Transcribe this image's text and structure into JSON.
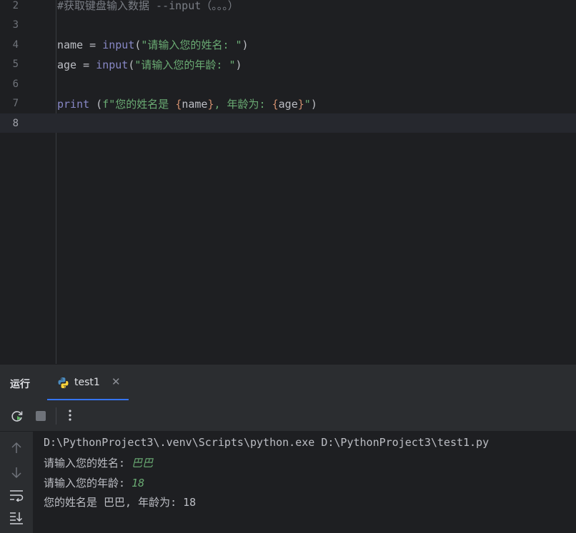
{
  "editor": {
    "lines": [
      {
        "number": "2",
        "tokens": [
          {
            "text": "#获取键盘输入数据 --input（。。。）",
            "kind": "comment"
          }
        ]
      },
      {
        "number": "3",
        "tokens": []
      },
      {
        "number": "4",
        "tokens": [
          {
            "text": "name",
            "kind": "ident"
          },
          {
            "text": " = ",
            "kind": "op"
          },
          {
            "text": "input",
            "kind": "builtin"
          },
          {
            "text": "(",
            "kind": "op"
          },
          {
            "text": "\"请输入您的姓名: \"",
            "kind": "str"
          },
          {
            "text": ")",
            "kind": "op"
          }
        ]
      },
      {
        "number": "5",
        "tokens": [
          {
            "text": "age",
            "kind": "ident"
          },
          {
            "text": " = ",
            "kind": "op"
          },
          {
            "text": "input",
            "kind": "builtin"
          },
          {
            "text": "(",
            "kind": "op"
          },
          {
            "text": "\"请输入您的年龄: \"",
            "kind": "str"
          },
          {
            "text": ")",
            "kind": "op"
          }
        ]
      },
      {
        "number": "6",
        "tokens": []
      },
      {
        "number": "7",
        "tokens": [
          {
            "text": "print",
            "kind": "builtin"
          },
          {
            "text": " (",
            "kind": "op"
          },
          {
            "text": "f",
            "kind": "fprefix"
          },
          {
            "text": "\"您的姓名是 ",
            "kind": "str"
          },
          {
            "text": "{",
            "kind": "brace"
          },
          {
            "text": "name",
            "kind": "ident"
          },
          {
            "text": "}",
            "kind": "brace"
          },
          {
            "text": ", 年龄为: ",
            "kind": "str"
          },
          {
            "text": "{",
            "kind": "brace"
          },
          {
            "text": "age",
            "kind": "ident"
          },
          {
            "text": "}",
            "kind": "brace"
          },
          {
            "text": "\"",
            "kind": "str"
          },
          {
            "text": ")",
            "kind": "op"
          }
        ]
      },
      {
        "number": "8",
        "tokens": [],
        "current": true
      }
    ]
  },
  "run_panel": {
    "title": "运行",
    "tab": {
      "label": "test1",
      "icon": "python-icon"
    },
    "toolbar": {
      "rerun_icon": "rerun-icon",
      "stop_icon": "stop-icon",
      "more_icon": "more-vertical-icon"
    },
    "side_icons": [
      "arrow-up-icon",
      "arrow-down-icon",
      "soft-wrap-icon",
      "scroll-to-end-icon"
    ],
    "console": {
      "command": "D:\\PythonProject3\\.venv\\Scripts\\python.exe D:\\PythonProject3\\test1.py",
      "prompt_name": "请输入您的姓名: ",
      "input_name": "巴巴",
      "prompt_age": "请输入您的年龄: ",
      "input_age": "18",
      "result": "您的姓名是 巴巴, 年龄为: 18"
    }
  },
  "colors": {
    "background": "#1e1f22",
    "panel": "#2b2d30",
    "accent": "#3574f0",
    "string": "#6aab73",
    "builtin": "#8888c6",
    "comment": "#7a7e85"
  }
}
